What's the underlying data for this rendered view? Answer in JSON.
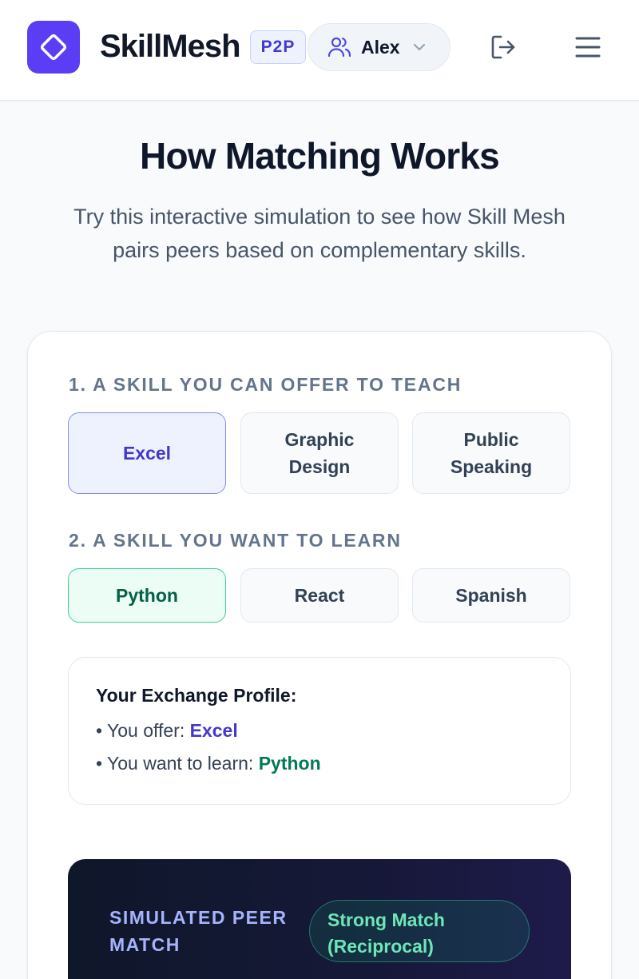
{
  "header": {
    "brand": "SkillMesh",
    "badge": "P2P",
    "user_name": "Alex",
    "icons": {
      "logo": "diamond-icon",
      "user": "users-icon",
      "dropdown": "chevron-down-icon",
      "logout": "logout-icon",
      "menu": "hamburger-menu-icon"
    }
  },
  "intro": {
    "title": "How Matching Works",
    "subtitle": "Try this interactive simulation to see how Skill Mesh pairs peers based on complementary skills."
  },
  "teach": {
    "label": "1. A SKILL YOU CAN OFFER TO TEACH",
    "options": [
      "Excel",
      "Graphic Design",
      "Public Speaking"
    ],
    "selected": "Excel"
  },
  "learn": {
    "label": "2. A SKILL YOU WANT TO LEARN",
    "options": [
      "Python",
      "React",
      "Spanish"
    ],
    "selected": "Python"
  },
  "profile": {
    "title": "Your Exchange Profile:",
    "offer_prefix": "• You offer: ",
    "offer_value": "Excel",
    "learn_prefix": "• You want to learn: ",
    "learn_value": "Python"
  },
  "peer": {
    "label": "SIMULATED PEER MATCH",
    "match_status": "Strong Match (Reciprocal)"
  },
  "colors": {
    "brand": "#5b3df5",
    "teach_accent": "#4338ca",
    "learn_accent": "#047857",
    "match_accent": "#6ee7b7"
  }
}
